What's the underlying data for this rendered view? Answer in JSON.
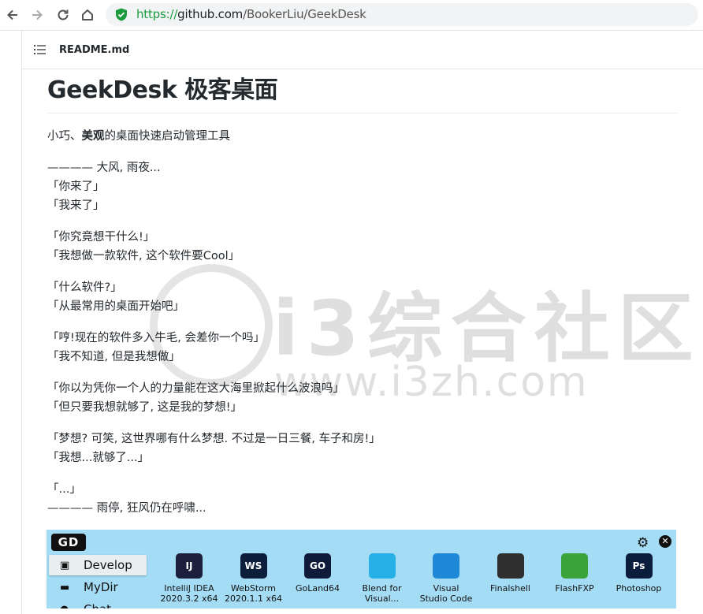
{
  "browser": {
    "url_scheme": "https://",
    "url_host": "github.com",
    "url_path": "/BookerLiu/GeekDesk"
  },
  "readme": {
    "file_name": "README.md",
    "title": "GeekDesk 极客桌面",
    "tagline_prefix": "小巧、",
    "tagline_bold": "美观",
    "tagline_suffix": "的桌面快速启动管理工具",
    "story": [
      [
        "———— 大风, 雨夜...",
        "「你来了」",
        "「我来了」"
      ],
      [
        "「你究竟想干什么!」",
        "「我想做一款软件, 这个软件要Cool」"
      ],
      [
        "「什么软件?」",
        "「从最常用的桌面开始吧」"
      ],
      [
        "「哼!现在的软件多入牛毛, 会差你一个吗」",
        "「我不知道, 但是我想做」"
      ],
      [
        "「你以为凭你一个人的力量能在这大海里掀起什么波浪吗」",
        "「但只要我想就够了, 这是我的梦想!」"
      ],
      [
        "「梦想? 可笑, 这世界哪有什么梦想. 不过是一日三餐, 车子和房!」",
        "「我想...就够了...」"
      ],
      [
        "「...」",
        "———— 雨停, 狂风仍在呼啸..."
      ]
    ]
  },
  "watermark": {
    "text": "i3综合社区",
    "url": "www.i3zh.com"
  },
  "app": {
    "logo": "GD",
    "sidebar": [
      {
        "label": "Develop",
        "icon": "terminal-icon",
        "active": true
      },
      {
        "label": "MyDir",
        "icon": "folder-icon",
        "active": false
      },
      {
        "label": "Chat",
        "icon": "chat-icon",
        "active": false
      }
    ],
    "tiles": [
      {
        "label1": "IntelliJ IDEA",
        "label2": "2020.3.2 x64",
        "abbr": "IJ",
        "color": "#1b1f3b"
      },
      {
        "label1": "WebStorm",
        "label2": "2020.1.1 x64",
        "abbr": "WS",
        "color": "#0b1e3a"
      },
      {
        "label1": "GoLand64",
        "label2": "",
        "abbr": "GO",
        "color": "#101a3a"
      },
      {
        "label1": "Blend for",
        "label2": "Visual...",
        "abbr": "",
        "color": "#27b0e5"
      },
      {
        "label1": "Visual",
        "label2": "Studio Code",
        "abbr": "",
        "color": "#1e88d6"
      },
      {
        "label1": "Finalshell",
        "label2": "",
        "abbr": "",
        "color": "#2f2f2f"
      },
      {
        "label1": "FlashFXP",
        "label2": "",
        "abbr": "",
        "color": "#3aa33a"
      },
      {
        "label1": "Photoshop",
        "label2": "",
        "abbr": "Ps",
        "color": "#0a1d3c"
      }
    ]
  }
}
